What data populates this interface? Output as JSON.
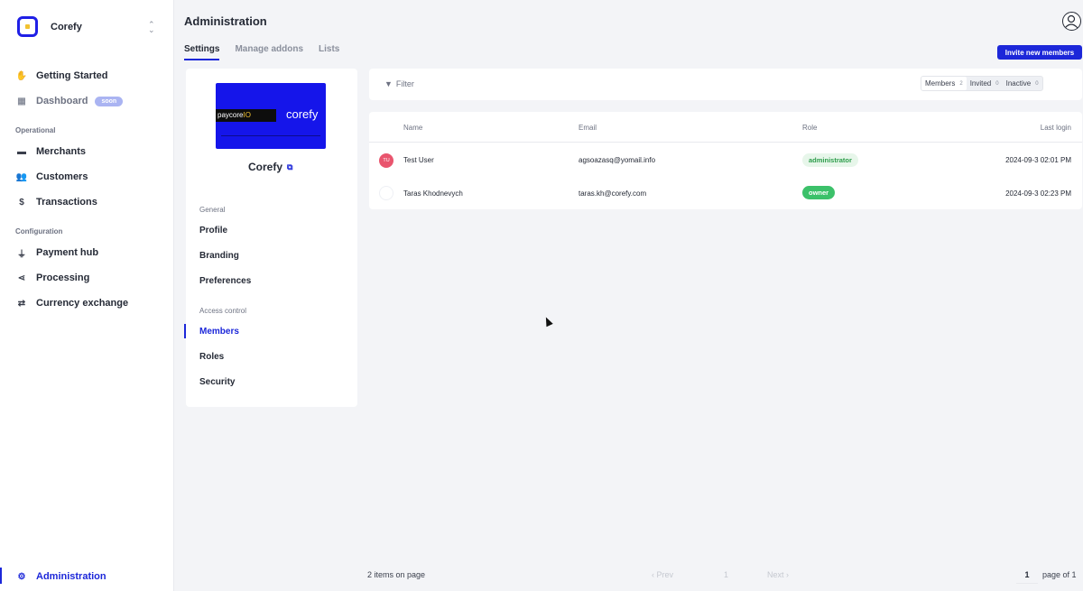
{
  "brand": {
    "name": "Corefy"
  },
  "sidebar": {
    "items": [
      {
        "label": "Getting Started",
        "icon": "wave-hand-icon"
      },
      {
        "label": "Dashboard",
        "badge": "soon",
        "icon": "dashboard-icon"
      }
    ],
    "operational_label": "Operational",
    "operational": [
      {
        "label": "Merchants",
        "icon": "store-icon"
      },
      {
        "label": "Customers",
        "icon": "users-icon"
      },
      {
        "label": "Transactions",
        "icon": "dollar-icon"
      }
    ],
    "configuration_label": "Configuration",
    "configuration": [
      {
        "label": "Payment hub",
        "icon": "plug-icon"
      },
      {
        "label": "Processing",
        "icon": "share-icon"
      },
      {
        "label": "Currency exchange",
        "icon": "exchange-icon"
      }
    ],
    "admin": {
      "label": "Administration",
      "icon": "gear-icon"
    }
  },
  "header": {
    "title": "Administration",
    "tabs": [
      {
        "label": "Settings"
      },
      {
        "label": "Manage addons"
      },
      {
        "label": "Lists"
      }
    ],
    "invite_button": "Invite new members"
  },
  "settings": {
    "logo": {
      "left": "paycore",
      "left_accent": "IO",
      "right": "corefy"
    },
    "org_name": "Corefy",
    "general_label": "General",
    "general": [
      "Profile",
      "Branding",
      "Preferences"
    ],
    "access_label": "Access control",
    "access": [
      "Members",
      "Roles",
      "Security"
    ]
  },
  "filter": {
    "label": "Filter",
    "segments": [
      {
        "label": "Members",
        "count": "2"
      },
      {
        "label": "Invited",
        "count": "0"
      },
      {
        "label": "Inactive",
        "count": "0"
      }
    ]
  },
  "table": {
    "columns": [
      "Name",
      "Email",
      "Role",
      "Last login"
    ],
    "rows": [
      {
        "initials": "TU",
        "name": "Test User",
        "email": "agsoazasq@yomail.info",
        "role": "administrator",
        "last_login": "2024-09-3 02:01 PM"
      },
      {
        "initials": "",
        "name": "Taras Khodnevych",
        "email": "taras.kh@corefy.com",
        "role": "owner",
        "last_login": "2024-09-3 02:23 PM"
      }
    ]
  },
  "footer": {
    "count": "2 items on page",
    "prev": "Prev",
    "page_num": "1",
    "next": "Next",
    "current_page": "1",
    "page_of": "page of 1"
  },
  "colors": {
    "accent": "#1c27d9",
    "admin_badge": "#e7f6ea",
    "owner_badge": "#3cc16a",
    "avatar": "#e9556e"
  }
}
